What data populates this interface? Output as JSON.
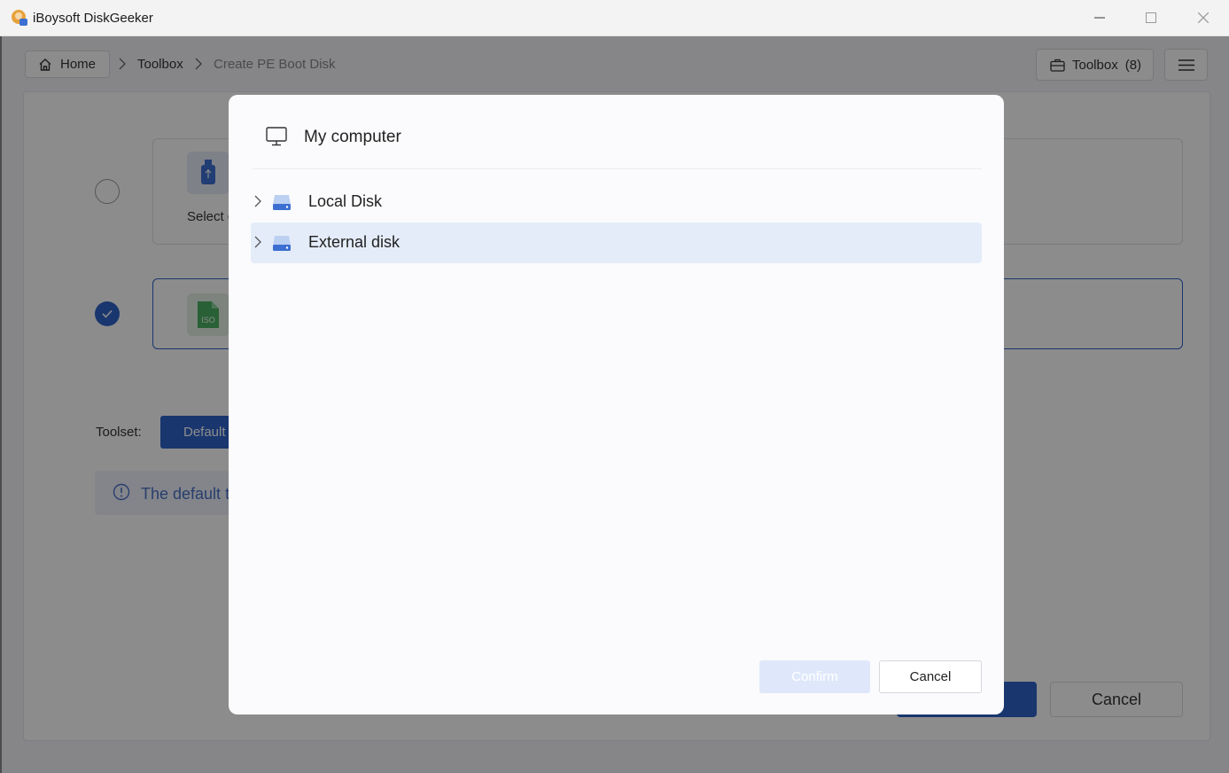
{
  "window": {
    "title": "iBoysoft DiskGeeker"
  },
  "breadcrumb": {
    "home": "Home",
    "toolbox": "Toolbox",
    "current": "Create PE Boot Disk"
  },
  "header": {
    "toolbox_label": "Toolbox",
    "toolbox_count": "(8)"
  },
  "options": [
    {
      "label": "Select d",
      "icon": "usb-drive-icon",
      "selected": false
    },
    {
      "label": "",
      "icon": "iso-file-icon",
      "selected": true,
      "icon_text": "ISO"
    }
  ],
  "toolset": {
    "label": "Toolset:",
    "button": "Default"
  },
  "info": {
    "text": "The default t"
  },
  "footer": {
    "cancel": "Cancel"
  },
  "dialog": {
    "title": "My computer",
    "items": [
      {
        "label": "Local Disk",
        "active": false
      },
      {
        "label": "External disk",
        "active": true
      }
    ],
    "confirm": "Confirm",
    "cancel": "Cancel"
  },
  "colors": {
    "accent": "#2e63c9",
    "selected_row": "#e4ecf9",
    "confirm_disabled": "#dfe8fa"
  }
}
